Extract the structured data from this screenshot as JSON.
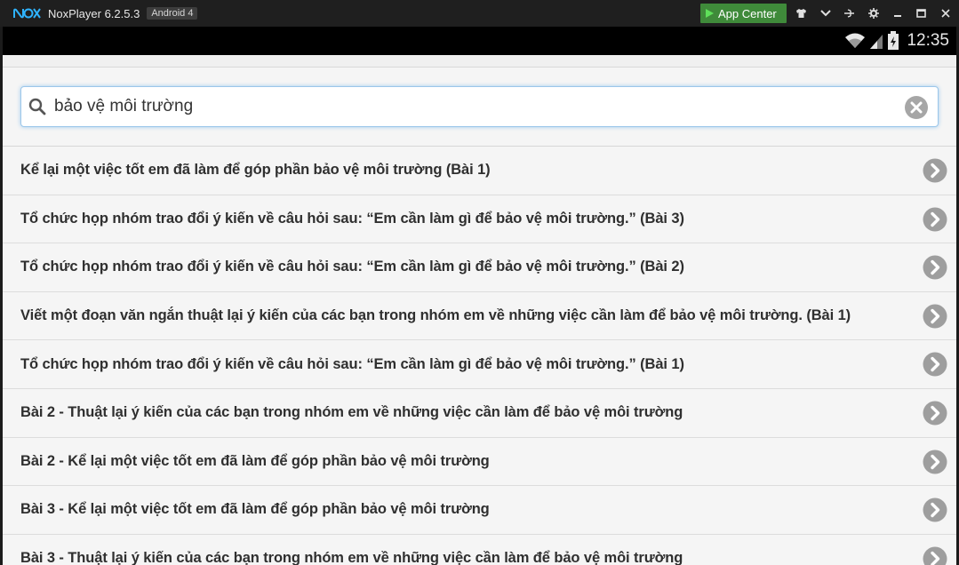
{
  "window": {
    "app_name": "NoxPlayer 6.2.5.3",
    "android_badge": "Android 4",
    "app_center_label": "App Center",
    "icons": [
      "shirt-icon",
      "chevron-down-icon",
      "pin-icon",
      "gear-icon",
      "minimize-icon",
      "maximize-icon",
      "close-icon"
    ]
  },
  "statusbar": {
    "time": "12:35",
    "icons": [
      "wifi-icon",
      "signal-icon",
      "battery-icon"
    ]
  },
  "search": {
    "value": "bảo vệ môi trường"
  },
  "results": [
    "Kể lại một việc tốt em đã làm để góp phần bảo vệ môi trường (Bài 1)",
    "Tổ chức họp nhóm trao đổi ý kiến về câu hỏi sau: “Em cần làm gì để bảo vệ môi trường.” (Bài 3)",
    "Tổ chức họp nhóm trao đổi ý kiến về câu hỏi sau: “Em cần làm gì để bảo vệ môi trường.” (Bài 2)",
    "Viết một đoạn văn ngắn thuật lại ý kiến của các bạn trong nhóm em về những việc cần làm để bảo vệ môi trường. (Bài 1)",
    "Tổ chức họp nhóm trao đổi ý kiến về câu hỏi sau: “Em cần làm gì để bảo vệ môi trường.” (Bài 1)",
    "Bài 2 - Thuật lại ý kiến của các bạn trong nhóm em về những việc cần làm để bảo vệ môi trường",
    "Bài 2 - Kể lại một việc tốt em đã làm để góp phần bảo vệ môi trường",
    "Bài 3 - Kể lại một việc tốt em đã làm để góp phần bảo vệ môi trường",
    "Bài 3 - Thuật lại ý kiến của các bạn trong nhóm em về những việc cần làm để bảo vệ môi trường"
  ],
  "colors": {
    "titlebar": "#1f1f1f",
    "app_center": "#3f8a3a",
    "search_border": "#9cc7ea",
    "chevron_circle": "#9e9e9e"
  }
}
